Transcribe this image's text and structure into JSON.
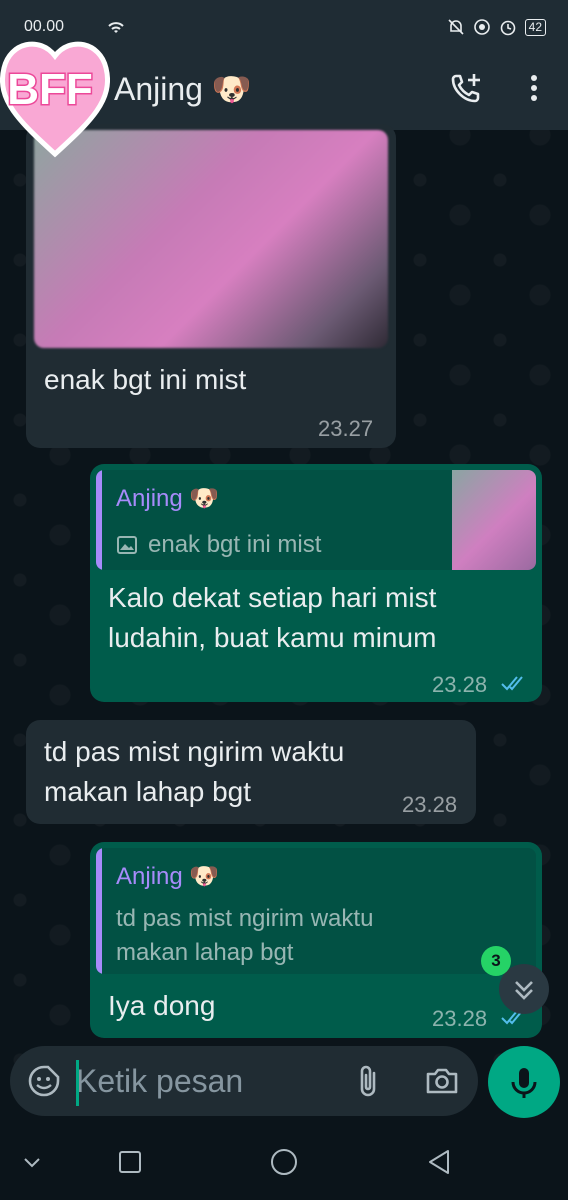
{
  "status_bar": {
    "time": "00.00",
    "battery": "42"
  },
  "header": {
    "contact_name": "Anjing 🐶",
    "sticker_text": "BFF"
  },
  "messages": [
    {
      "type": "incoming-image",
      "text": "enak bgt ini mist",
      "time": "23.27"
    },
    {
      "type": "outgoing-reply",
      "quote_author": "Anjing 🐶",
      "quote_text": "enak bgt ini mist",
      "text_line1": "Kalo dekat setiap hari mist",
      "text_line2": "ludahin, buat kamu minum",
      "time": "23.28"
    },
    {
      "type": "incoming",
      "text_line1": "td pas mist ngirim waktu",
      "text_line2": "makan lahap bgt",
      "time": "23.28"
    },
    {
      "type": "outgoing-reply",
      "quote_author": "Anjing 🐶",
      "quote_text_line1": "td pas mist ngirim waktu",
      "quote_text_line2": "makan lahap bgt",
      "text": "Iya dong",
      "time": "23.28"
    }
  ],
  "scroll_to_bottom": {
    "unread_count": "3"
  },
  "input": {
    "placeholder": "Ketik pesan"
  },
  "colors": {
    "incoming_bubble": "#202c33",
    "outgoing_bubble": "#005c4b",
    "accent": "#00a884",
    "read_ticks": "#53bdeb"
  }
}
